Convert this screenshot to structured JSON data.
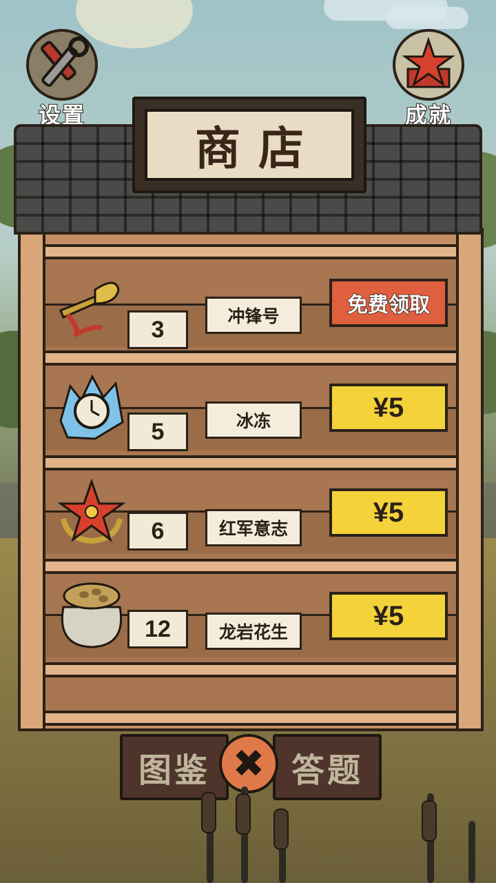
{
  "header": {
    "settings_label": "设置",
    "achievements_label": "成就",
    "shop_title": "商店"
  },
  "shop": {
    "items": [
      {
        "name": "冲锋号",
        "count": "3",
        "action": "免费领取",
        "icon": "bugle-icon"
      },
      {
        "name": "冰冻",
        "count": "5",
        "action": "¥5",
        "icon": "frozen-clock-icon"
      },
      {
        "name": "红军意志",
        "count": "6",
        "action": "¥5",
        "icon": "red-star-emblem-icon"
      },
      {
        "name": "龙岩花生",
        "count": "12",
        "action": "¥5",
        "icon": "peanut-sack-icon"
      }
    ]
  },
  "footer": {
    "catalog_label": "图鉴",
    "quiz_label": "答题",
    "close_icon": "close-icon"
  },
  "colors": {
    "free_button": "#e05f3e",
    "price_button": "#f4d33a",
    "wood": "#c58e62"
  }
}
